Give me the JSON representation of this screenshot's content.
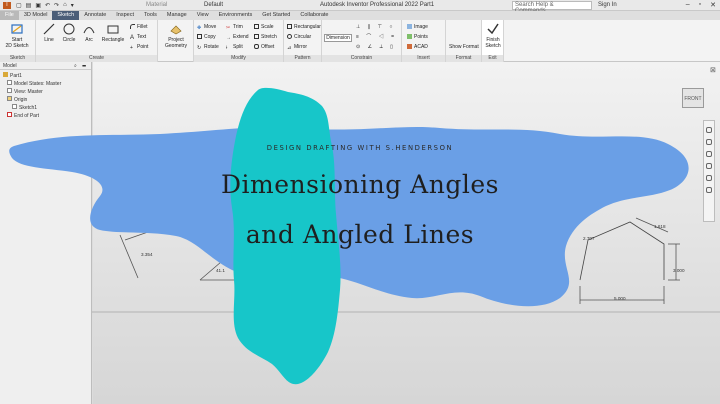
{
  "titlebar": {
    "logo": "I",
    "quick_access": [
      "File",
      "3D Model"
    ],
    "material": "Material",
    "appearance": "Default",
    "app_title": "Autodesk Inventor Professional 2022   Part1",
    "search_placeholder": "Search Help & Commands...",
    "sign_in": "Sign In"
  },
  "tabs": [
    "File",
    "3D Model",
    "Sketch",
    "Annotate",
    "Inspect",
    "Tools",
    "Manage",
    "View",
    "Environments",
    "Get Started",
    "Collaborate"
  ],
  "ribbon": {
    "sketch": {
      "start_label": "Start\n2D Sketch",
      "panel": "Sketch"
    },
    "create": {
      "line": "Line",
      "circle": "Circle",
      "arc": "Arc",
      "rectangle": "Rectangle",
      "fillet": "Fillet",
      "text": "Text",
      "point": "Point",
      "panel": "Create"
    },
    "project": {
      "label": "Project\nGeometry"
    },
    "modify": {
      "move": "Move",
      "copy": "Copy",
      "rotate": "Rotate",
      "trim": "Trim",
      "extend": "Extend",
      "split": "Split",
      "scale": "Scale",
      "stretch": "Stretch",
      "offset": "Offset",
      "panel": "Modify"
    },
    "pattern": {
      "rectangular": "Rectangular",
      "circular": "Circular",
      "mirror": "Mirror",
      "panel": "Pattern"
    },
    "constrain": {
      "dimension": "Dimension",
      "panel": "Constrain"
    },
    "insert": {
      "image": "Image",
      "points": "Points",
      "acad": "ACAD",
      "panel": "Insert"
    },
    "format": {
      "show_format": "Show Format",
      "panel": "Format"
    },
    "exit": {
      "finish": "Finish\nSketch",
      "panel": "Exit"
    }
  },
  "browser": {
    "title": "Model",
    "tree": [
      "Part1",
      "Model States: Master",
      "View: Master",
      "Origin",
      "Sketch1",
      "End of Part"
    ]
  },
  "canvas": {
    "viewcube": "FRONT",
    "dims": {
      "d1": "3.354",
      "d2": "41.1",
      "d3": "2.707",
      "d4": "1.618",
      "d5": "3.000",
      "d6": "5.000"
    }
  },
  "overlay": {
    "subtitle": "DESIGN DRAFTING WITH S.HENDERSON",
    "title_line1": "Dimensioning Angles",
    "title_line2": "and Angled Lines",
    "colors": {
      "blue_splash": "#6a9fe6",
      "teal_splash": "#17c6c9"
    }
  }
}
